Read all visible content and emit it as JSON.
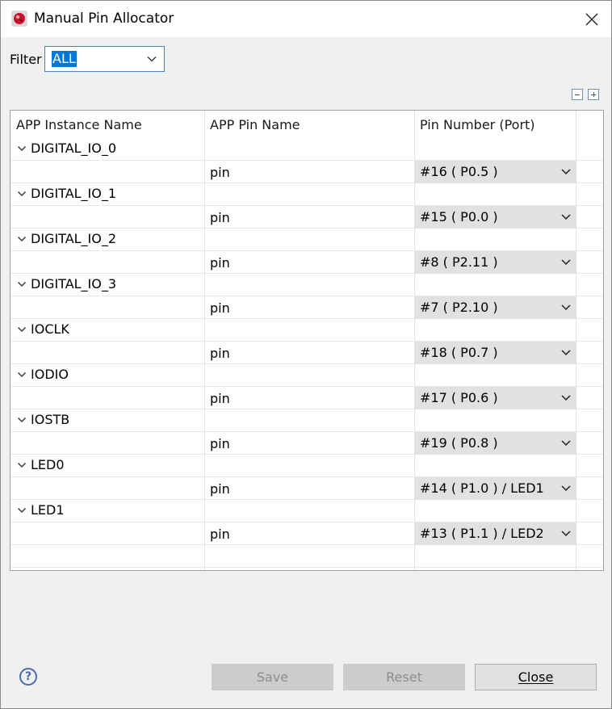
{
  "window": {
    "title": "Manual Pin Allocator",
    "icon": "app-chip-icon"
  },
  "filter": {
    "label": "Filter",
    "value": "ALL"
  },
  "tree_controls": {
    "collapse_icon": "collapse-all-icon",
    "expand_icon": "expand-all-icon"
  },
  "table": {
    "columns": [
      "APP Instance Name",
      "APP Pin Name",
      "Pin Number (Port)"
    ],
    "groups": [
      {
        "instance": "DIGITAL_IO_0",
        "pin": "pin",
        "number": "#16 ( P0.5 )"
      },
      {
        "instance": "DIGITAL_IO_1",
        "pin": "pin",
        "number": "#15 ( P0.0 )"
      },
      {
        "instance": "DIGITAL_IO_2",
        "pin": "pin",
        "number": "#8 ( P2.11 )"
      },
      {
        "instance": "DIGITAL_IO_3",
        "pin": "pin",
        "number": "#7 ( P2.10 )"
      },
      {
        "instance": "IOCLK",
        "pin": "pin",
        "number": "#18 ( P0.7 )"
      },
      {
        "instance": "IODIO",
        "pin": "pin",
        "number": "#17 ( P0.6 )"
      },
      {
        "instance": "IOSTB",
        "pin": "pin",
        "number": "#19 ( P0.8 )"
      },
      {
        "instance": "LED0",
        "pin": "pin",
        "number": "#14 ( P1.0 ) / LED1"
      },
      {
        "instance": "LED1",
        "pin": "pin",
        "number": "#13 ( P1.1 ) / LED2"
      }
    ]
  },
  "buttons": {
    "save": "Save",
    "reset": "Reset",
    "close": "Close"
  },
  "help": {
    "icon": "help-icon",
    "glyph": "?"
  },
  "colors": {
    "selection": "#0078d7",
    "combo_bg": "#e1e1e1",
    "window_bg": "#f0f0f0"
  }
}
